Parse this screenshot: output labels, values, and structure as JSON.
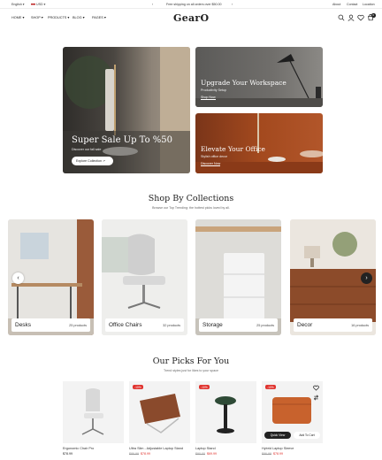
{
  "topbar": {
    "language": "English",
    "currency": "USD",
    "announcement": "Free shipping on all orders over $50.00",
    "links": [
      "About",
      "Contact",
      "Location"
    ]
  },
  "header": {
    "logo": "GearO",
    "nav": [
      "HOME",
      "SHOP",
      "PRODUCTS",
      "BLOG",
      "PAGES"
    ],
    "cart_count": "0"
  },
  "hero": {
    "main": {
      "title": "Super Sale Up To %50",
      "subtitle": "Discover our fall sale",
      "cta": "Explore Collection"
    },
    "top_right": {
      "title": "Upgrade Your Workspace",
      "subtitle": "Productivity Setup",
      "cta": "Shop Now"
    },
    "bottom_right": {
      "title": "Elevate Your Office",
      "subtitle": "Stylish office decor",
      "cta": "Discover Now"
    }
  },
  "collections": {
    "title": "Shop By Collections",
    "subtitle": "Browse our Top Trending: the hottest picks loved by all.",
    "items": [
      {
        "name": "Desks",
        "count": "25 products"
      },
      {
        "name": "Office Chairs",
        "count": "32 products"
      },
      {
        "name": "Storage",
        "count": "25 products"
      },
      {
        "name": "Decor",
        "count": "16 products"
      }
    ]
  },
  "picks": {
    "title": "Our Picks For You",
    "subtitle": "Trend styles just for likes to your space",
    "quick_view": "Quick View",
    "add_to_cart": "Add To Cart",
    "items": [
      {
        "name": "Ergonomic Chair Pro",
        "price": "$78.99",
        "old_price": "",
        "badge": ""
      },
      {
        "name": "Ultra Slim - Adjustable Laptop Stand",
        "price": "$78.99",
        "old_price": "$86.99",
        "badge": "-10%"
      },
      {
        "name": "Laptop Stand",
        "price": "$69.99",
        "old_price": "$90.00",
        "badge": "-10%"
      },
      {
        "name": "Hybrid Laptop Sleeve",
        "price": "$78.99",
        "old_price": "$86.99",
        "badge": "-10%"
      }
    ]
  },
  "colors": {
    "sale": "#e0342f",
    "dark": "#222222",
    "background": "#ffffff"
  }
}
